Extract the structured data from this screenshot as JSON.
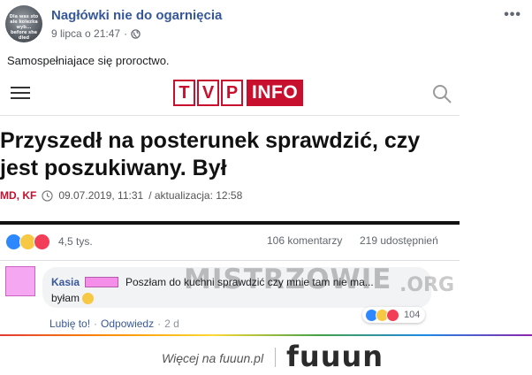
{
  "post": {
    "group_name": "Nagłówki nie do ogarnięcia",
    "avatar_text": "Dla was sto ale kolezka wyb... before she died",
    "date": "9 lipca o 21:47",
    "date_separator": "·",
    "more_label": "•••",
    "text": "Samospełniajace się proroctwo."
  },
  "article": {
    "logo_letters": [
      "T",
      "V",
      "P"
    ],
    "logo_suffix": "INFO",
    "headline": "Przyszedł na posterunek sprawdzić, czy jest poszukiwany. Był",
    "authors": "MD, KF",
    "published": "09.07.2019, 11:31",
    "updated": "/ aktualizacja: 12:58"
  },
  "reactions": {
    "count": "4,5 tys.",
    "comments": "106 komentarzy",
    "shares": "219 udostępnień"
  },
  "comment": {
    "author": "Kasia",
    "text_line1": "Poszłam do kuchni sprawdzić czy mnie tam nie ma...",
    "text_line2": "byłam",
    "watermark": "MISTRZOWIE",
    "watermark_suffix": ".ORG",
    "reaction_count": "104",
    "like_label": "Lubię to!",
    "reply_label": "Odpowiedz",
    "age": "2 d",
    "separator": "·"
  },
  "footer": {
    "text": "Więcej na fuuun.pl",
    "brand": "fuuun"
  },
  "colors": {
    "brand_red": "#c8102e",
    "fb_link": "#365899",
    "like_blue": "#2d88ff",
    "haha_yellow": "#f7c843",
    "love_red": "#f33e58",
    "redaction_pink": "#f48ee9"
  }
}
